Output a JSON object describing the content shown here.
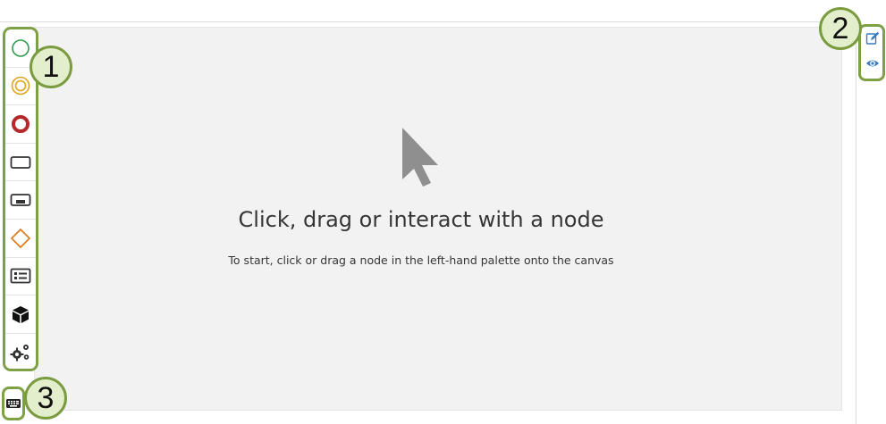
{
  "canvas": {
    "empty_title": "Click, drag or interact with a node",
    "empty_subtitle": "To start, click or drag a node in the left-hand palette onto the canvas"
  },
  "palette": {
    "items": [
      {
        "name": "start-event",
        "icon": "circle-thin-icon",
        "color": "#2e9c4a"
      },
      {
        "name": "intermediate-event",
        "icon": "double-circle-icon",
        "color": "#e0a31e"
      },
      {
        "name": "end-event",
        "icon": "circle-thick-icon",
        "color": "#b42a2a"
      },
      {
        "name": "task",
        "icon": "rectangle-icon",
        "color": "#333333"
      },
      {
        "name": "sub-process",
        "icon": "rectangle-collapsed-icon",
        "color": "#333333"
      },
      {
        "name": "gateway",
        "icon": "diamond-icon",
        "color": "#e07b1e"
      },
      {
        "name": "data-object",
        "icon": "list-card-icon",
        "color": "#333333"
      },
      {
        "name": "cube",
        "icon": "cube-icon",
        "color": "#111111"
      },
      {
        "name": "settings",
        "icon": "gears-icon",
        "color": "#333333"
      }
    ]
  },
  "toolbar": {
    "edit_icon": "edit-icon",
    "view_icon": "eye-icon",
    "accent_color": "#3b7bbf"
  },
  "keyboard": {
    "icon": "keyboard-icon"
  },
  "callouts": [
    "1",
    "2",
    "3"
  ],
  "colors": {
    "highlight_border": "#7ea046",
    "callout_fill": "#e3eecd",
    "canvas_bg": "#f2f2f2"
  }
}
